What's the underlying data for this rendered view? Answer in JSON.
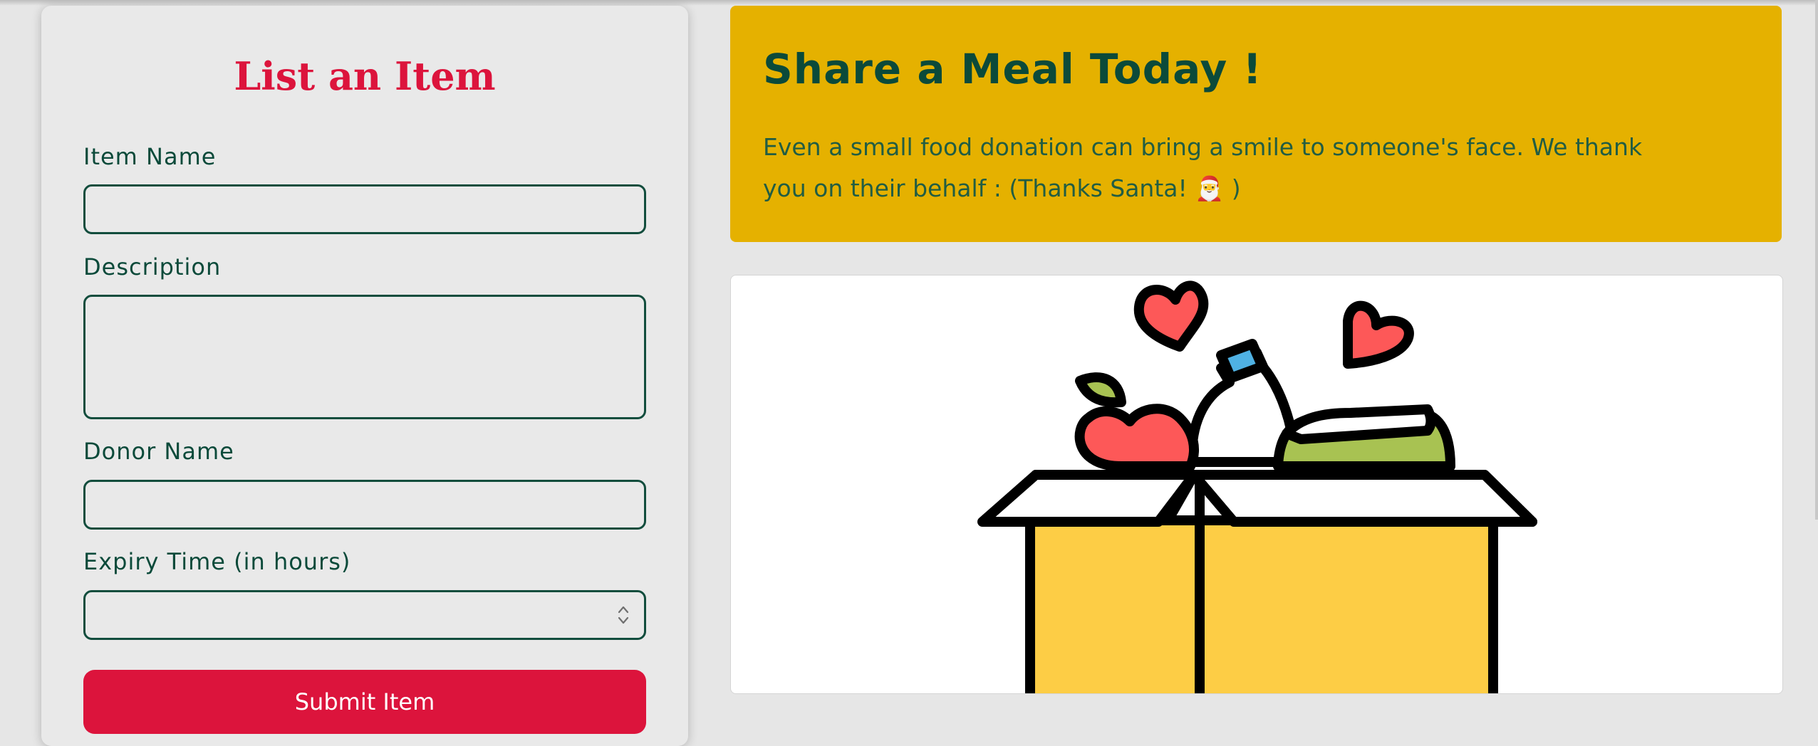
{
  "form": {
    "title": "List an Item",
    "fields": [
      {
        "label": "Item Name",
        "value": ""
      },
      {
        "label": "Description",
        "value": ""
      },
      {
        "label": "Donor Name",
        "value": ""
      },
      {
        "label": "Expiry Time (in hours)",
        "value": ""
      }
    ],
    "submit_label": "Submit Item"
  },
  "banner": {
    "title": "Share a Meal Today !",
    "text": "Even a small food donation can bring a smile to someone's face. We thank you on their behalf : (Thanks Santa! 🎅 )"
  },
  "illustration": {
    "icon": "food-donation-box-illustration"
  },
  "colors": {
    "accent": "#dc143c",
    "banner_bg": "#e5b100",
    "text_dark": "#0b4a3a",
    "box_yellow": "#fdcd45",
    "apple_red": "#fd5858",
    "jar_green": "#a8c252",
    "bottle_cap": "#4fb1e3"
  }
}
